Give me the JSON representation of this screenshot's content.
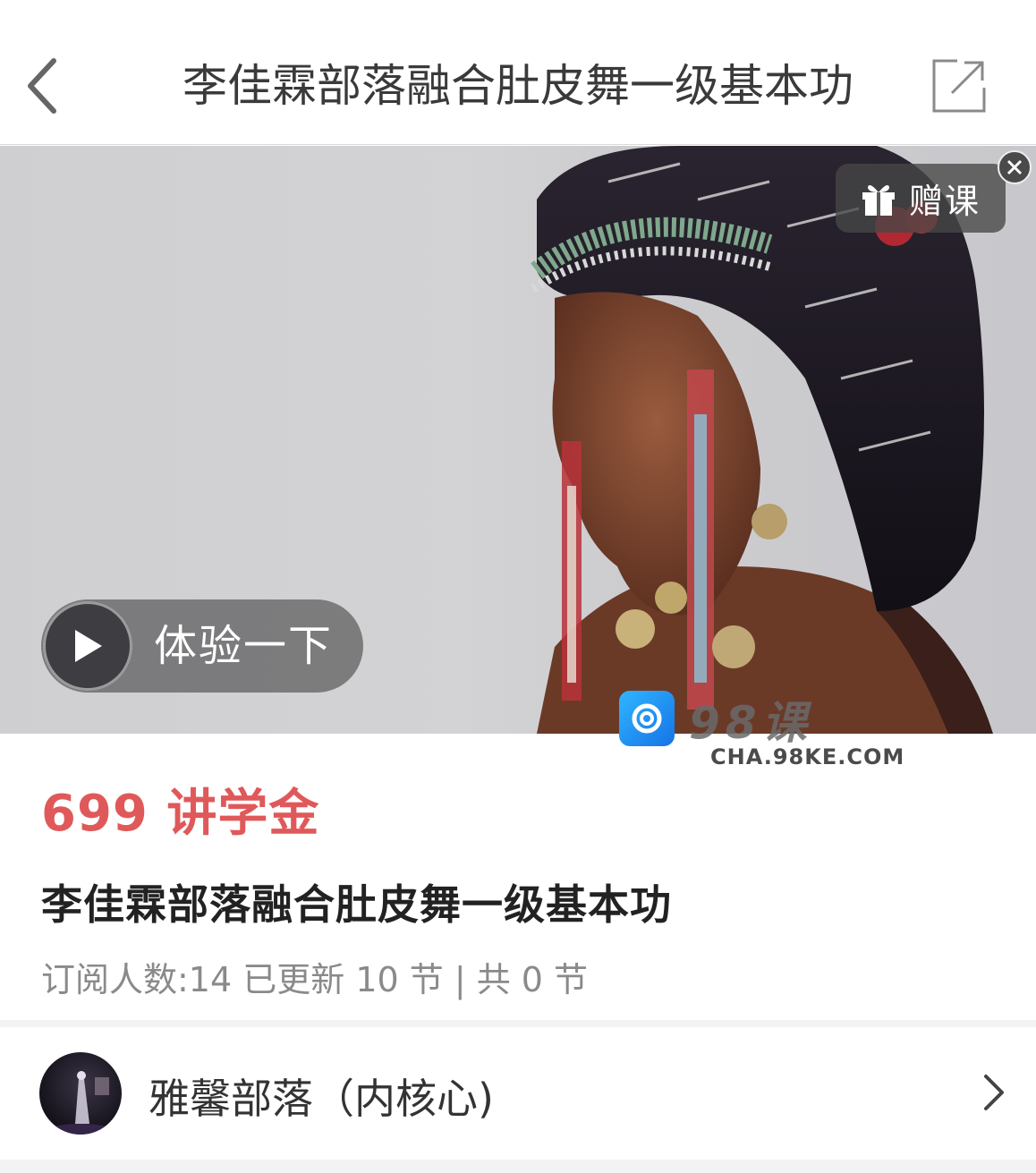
{
  "header": {
    "title": "李佳霖部落融合肚皮舞一级基本功"
  },
  "hero": {
    "gift_label": "赠课",
    "trial_label": "体验一下",
    "watermark_text": "98课",
    "watermark_url": "CHA.98KE.COM"
  },
  "course": {
    "price": "699 讲学金",
    "title": "李佳霖部落融合肚皮舞一级基本功",
    "meta": "订阅人数:14 已更新 10 节 | 共 0 节"
  },
  "author": {
    "name": "雅馨部落（内核心)"
  },
  "colors": {
    "price": "#e0595a",
    "title": "#222222",
    "meta": "#8a8a8a",
    "header_bg": "#ffffff"
  }
}
